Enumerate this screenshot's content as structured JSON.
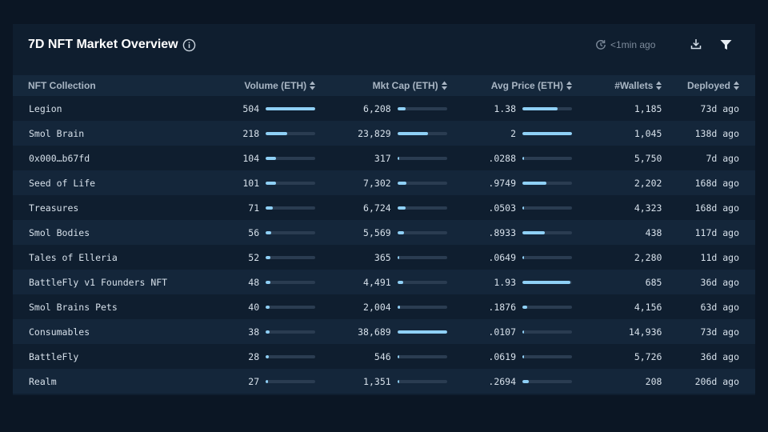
{
  "header": {
    "title": "7D NFT Market Overview",
    "updated": "<1min ago"
  },
  "colors": {
    "background": "#0b1624",
    "panel": "#0f1e2f",
    "row_alt": "#14263a",
    "header_row": "#15283c",
    "bar_fill": "#8fd0f6",
    "bar_track": "#2a3c51"
  },
  "icons": {
    "info": "info-icon",
    "clock": "clock-icon",
    "download": "download-icon",
    "filter": "filter-icon",
    "sort": "sort-icon"
  },
  "table": {
    "columns": [
      "NFT Collection",
      "Volume (ETH)",
      "Mkt Cap (ETH)",
      "Avg Price (ETH)",
      "#Wallets",
      "Deployed"
    ],
    "rows": [
      {
        "name": "Legion",
        "volume": "504",
        "volume_pct": 100,
        "mktcap": "6,208",
        "mktcap_pct": 16,
        "avg": "1.38",
        "avg_pct": 71,
        "wallets": "1,185",
        "deployed": "73d ago"
      },
      {
        "name": "Smol Brain",
        "volume": "218",
        "volume_pct": 43,
        "mktcap": "23,829",
        "mktcap_pct": 62,
        "avg": "2",
        "avg_pct": 100,
        "wallets": "1,045",
        "deployed": "138d ago"
      },
      {
        "name": "0x000…b67fd",
        "volume": "104",
        "volume_pct": 21,
        "mktcap": "317",
        "mktcap_pct": 1,
        "avg": ".0288",
        "avg_pct": 2,
        "wallets": "5,750",
        "deployed": "7d ago"
      },
      {
        "name": "Seed of Life",
        "volume": "101",
        "volume_pct": 20,
        "mktcap": "7,302",
        "mktcap_pct": 19,
        "avg": ".9749",
        "avg_pct": 49,
        "wallets": "2,202",
        "deployed": "168d ago"
      },
      {
        "name": "Treasures",
        "volume": "71",
        "volume_pct": 14,
        "mktcap": "6,724",
        "mktcap_pct": 17,
        "avg": ".0503",
        "avg_pct": 3,
        "wallets": "4,323",
        "deployed": "168d ago"
      },
      {
        "name": "Smol Bodies",
        "volume": "56",
        "volume_pct": 11,
        "mktcap": "5,569",
        "mktcap_pct": 14,
        "avg": ".8933",
        "avg_pct": 45,
        "wallets": "438",
        "deployed": "117d ago"
      },
      {
        "name": "Tales of Elleria",
        "volume": "52",
        "volume_pct": 10,
        "mktcap": "365",
        "mktcap_pct": 1,
        "avg": ".0649",
        "avg_pct": 3,
        "wallets": "2,280",
        "deployed": "11d ago"
      },
      {
        "name": "BattleFly v1 Founders NFT",
        "volume": "48",
        "volume_pct": 10,
        "mktcap": "4,491",
        "mktcap_pct": 12,
        "avg": "1.93",
        "avg_pct": 97,
        "wallets": "685",
        "deployed": "36d ago"
      },
      {
        "name": "Smol Brains Pets",
        "volume": "40",
        "volume_pct": 8,
        "mktcap": "2,004",
        "mktcap_pct": 5,
        "avg": ".1876",
        "avg_pct": 9,
        "wallets": "4,156",
        "deployed": "63d ago"
      },
      {
        "name": "Consumables",
        "volume": "38",
        "volume_pct": 8,
        "mktcap": "38,689",
        "mktcap_pct": 100,
        "avg": ".0107",
        "avg_pct": 1,
        "wallets": "14,936",
        "deployed": "73d ago"
      },
      {
        "name": "BattleFly",
        "volume": "28",
        "volume_pct": 6,
        "mktcap": "546",
        "mktcap_pct": 1,
        "avg": ".0619",
        "avg_pct": 3,
        "wallets": "5,726",
        "deployed": "36d ago"
      },
      {
        "name": "Realm",
        "volume": "27",
        "volume_pct": 5,
        "mktcap": "1,351",
        "mktcap_pct": 3,
        "avg": ".2694",
        "avg_pct": 13,
        "wallets": "208",
        "deployed": "206d ago"
      }
    ]
  }
}
